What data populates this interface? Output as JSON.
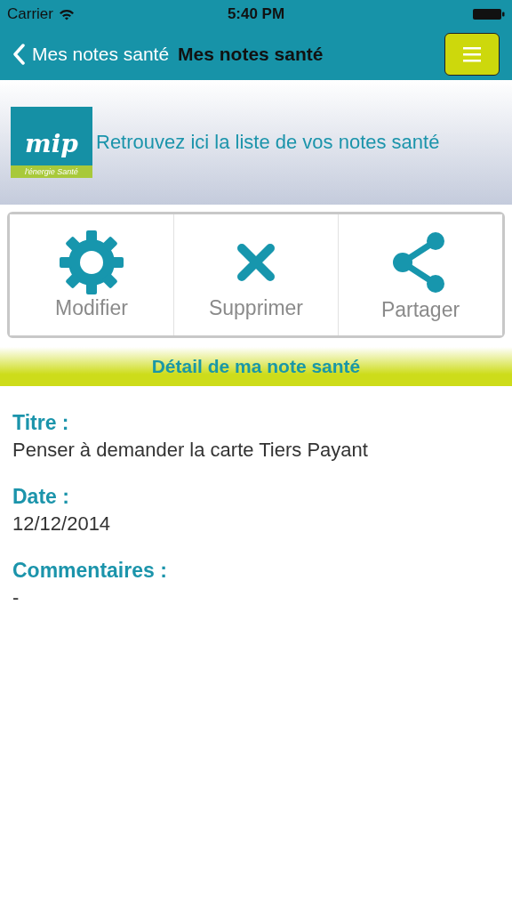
{
  "status_bar": {
    "carrier": "Carrier",
    "time": "5:40 PM"
  },
  "nav": {
    "back_label": "Mes notes santé",
    "title": "Mes notes santé"
  },
  "banner": {
    "logo_word": "mip",
    "logo_tagline": "l'énergie Santé",
    "text": "Retrouvez ici la liste de vos notes santé"
  },
  "actions": [
    {
      "kind": "gear",
      "label": "Modifier"
    },
    {
      "kind": "close",
      "label": "Supprimer"
    },
    {
      "kind": "share",
      "label": "Partager"
    }
  ],
  "section_title": "Détail de ma note santé",
  "fields": [
    {
      "label": "Titre :",
      "value": "Penser à demander la carte Tiers Payant"
    },
    {
      "label": "Date :",
      "value": "12/12/2014"
    },
    {
      "label": "Commentaires :",
      "value": "-"
    }
  ]
}
